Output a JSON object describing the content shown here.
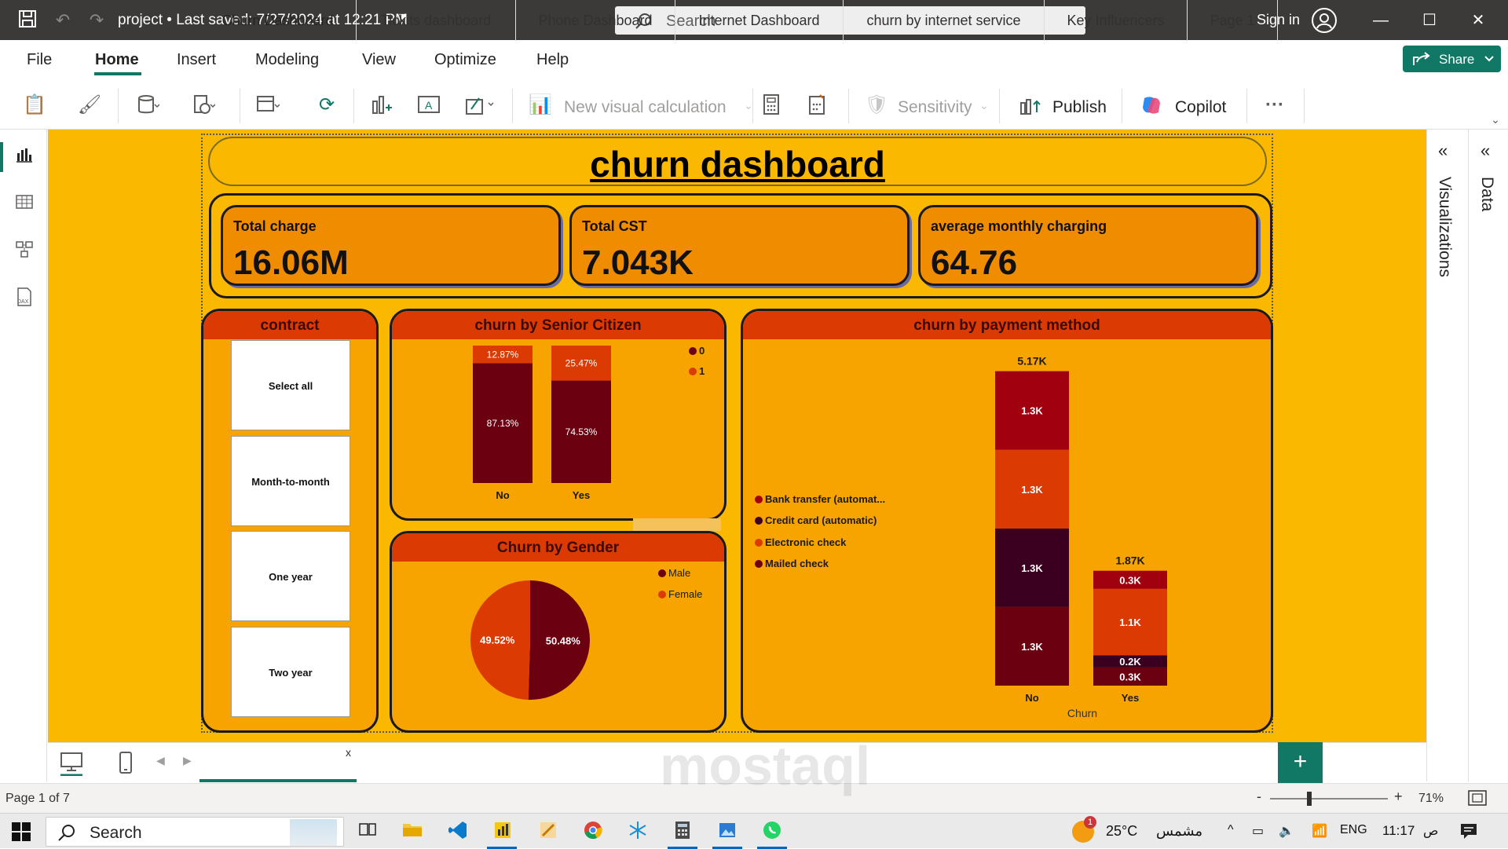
{
  "titlebar": {
    "title": "project • Last saved: 7/27/2024 at 12:21 PM",
    "search_placeholder": "Search",
    "sign_in": "Sign in"
  },
  "menu": {
    "items": [
      "File",
      "Home",
      "Insert",
      "Modeling",
      "View",
      "Optimize",
      "Help"
    ],
    "share": "Share"
  },
  "ribbon": {
    "new_visual_calc": "New visual calculation",
    "sensitivity": "Sensitivity",
    "publish": "Publish",
    "copilot": "Copilot"
  },
  "right_pane": {
    "visualizations": "Visualizations",
    "data": "Data"
  },
  "report": {
    "title": "churn dashboard",
    "kpis": [
      {
        "label": "Total charge",
        "value": "16.06M"
      },
      {
        "label": "Total CST",
        "value": "7.043K"
      },
      {
        "label": "average monthly charging",
        "value": "64.76"
      }
    ],
    "contract": {
      "title": "contract",
      "items": [
        "Select all",
        "Month-to-month",
        "One year",
        "Two year"
      ]
    },
    "senior": {
      "title": "churn by Senior Citizen",
      "legend": [
        "0",
        "1"
      ]
    },
    "gender": {
      "title": "Churn by Gender",
      "legend": [
        "Male",
        "Female"
      ]
    },
    "payment": {
      "title": "churn by payment method",
      "legend": [
        "Bank transfer (automat...",
        "Credit card (automatic)",
        "Electronic check",
        "Mailed check"
      ],
      "x_title": "Churn"
    }
  },
  "colors": {
    "dark_maroon": "#6b0010",
    "red_orange": "#db3a03",
    "plum": "#3b0020",
    "canvas": "#fab800",
    "accent": "#117865"
  },
  "chart_data": [
    {
      "type": "bar",
      "stacked": true,
      "percent": true,
      "title": "churn by Senior Citizen",
      "categories": [
        "No",
        "Yes"
      ],
      "series": [
        {
          "name": "0",
          "values": [
            87.13,
            74.53
          ],
          "labels": [
            "87.13%",
            "74.53%"
          ],
          "color": "#6b0010"
        },
        {
          "name": "1",
          "values": [
            12.87,
            25.47
          ],
          "labels": [
            "12.87%",
            "25.47%"
          ],
          "color": "#db3a03"
        }
      ]
    },
    {
      "type": "pie",
      "title": "Churn by Gender",
      "slices": [
        {
          "name": "Male",
          "value": 50.48,
          "label": "50.48%",
          "color": "#6b0010"
        },
        {
          "name": "Female",
          "value": 49.52,
          "label": "49.52%",
          "color": "#db3a03"
        }
      ]
    },
    {
      "type": "bar",
      "stacked": true,
      "title": "churn by payment method",
      "xlabel": "Churn",
      "categories": [
        "No",
        "Yes"
      ],
      "totals": [
        "5.17K",
        "1.87K"
      ],
      "series": [
        {
          "name": "Mailed check",
          "values": [
            1.3,
            0.3
          ],
          "labels": [
            "1.3K",
            "0.3K"
          ],
          "color": "#6b0010"
        },
        {
          "name": "Credit card (automatic)",
          "values": [
            1.3,
            0.2
          ],
          "labels": [
            "1.3K",
            "0.2K"
          ],
          "color": "#3b0020"
        },
        {
          "name": "Electronic check",
          "values": [
            1.3,
            1.1
          ],
          "labels": [
            "1.3K",
            "1.1K"
          ],
          "color": "#db3a03"
        },
        {
          "name": "Bank transfer (automat...",
          "values": [
            1.3,
            0.3
          ],
          "labels": [
            "1.3K",
            "0.3K"
          ],
          "color": "#a1000e"
        }
      ]
    }
  ],
  "tabs": [
    "Churn Dashboard",
    "Tickits dashboard",
    "Phone Dashboard",
    "Internet Dashboard",
    "churn by internet service",
    "Key Influencers",
    "Page 1"
  ],
  "tab_close": "x",
  "status": {
    "page": "Page 1 of 7",
    "zoom": "71%"
  },
  "taskbar": {
    "search": "Search",
    "temp": "25°C",
    "weather": "مشمس",
    "lang": "ENG",
    "time": "11:17",
    "ampm": "ص",
    "weather_badge": "1"
  }
}
